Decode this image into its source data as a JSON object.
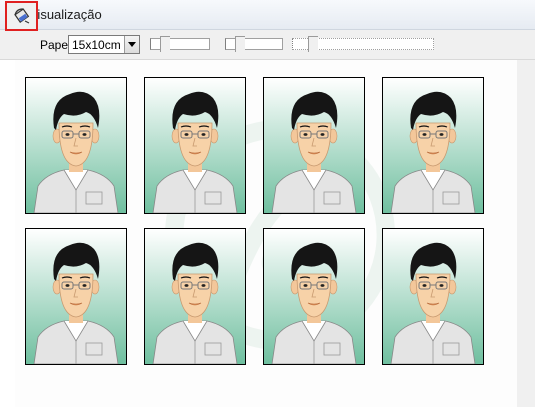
{
  "window": {
    "title": "Visualização",
    "icon": "film-strip-icon"
  },
  "toolbar": {
    "rotate_icon": "paint-bucket-rotate-icon",
    "paper_label": "Papel",
    "paper_value": "15x10cm",
    "highlight_color": "#e02020"
  },
  "sliders": [
    {
      "name": "slider-1",
      "value": 0
    },
    {
      "name": "slider-2",
      "value": 0
    },
    {
      "name": "slider-3",
      "value": 0
    }
  ],
  "photos": {
    "rows": 2,
    "columns": 4,
    "count": 8,
    "background_gradient": [
      "#ffffff",
      "#6fbf9f"
    ]
  }
}
